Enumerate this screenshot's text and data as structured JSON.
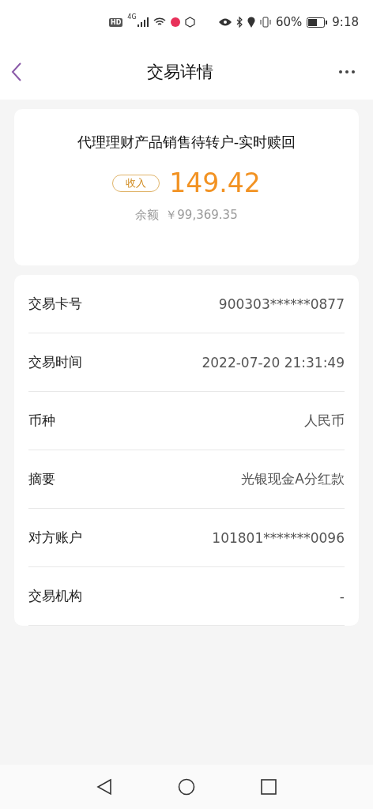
{
  "status_bar": {
    "hd": "HD",
    "network": "4G",
    "battery": "60%",
    "time": "9:18"
  },
  "header": {
    "title": "交易详情"
  },
  "summary": {
    "title": "代理理财产品销售待转户-实时赎回",
    "direction": "收入",
    "amount": "149.42",
    "balance_label": "余额",
    "balance": "￥99,369.35"
  },
  "details": [
    {
      "label": "交易卡号",
      "value": "900303******0877"
    },
    {
      "label": "交易时间",
      "value": "2022-07-20 21:31:49"
    },
    {
      "label": "币种",
      "value": "人民币"
    },
    {
      "label": "摘要",
      "value": "光银现金A分红款"
    },
    {
      "label": "对方账户",
      "value": "101801*******0096"
    },
    {
      "label": "交易机构",
      "value": "-"
    }
  ]
}
